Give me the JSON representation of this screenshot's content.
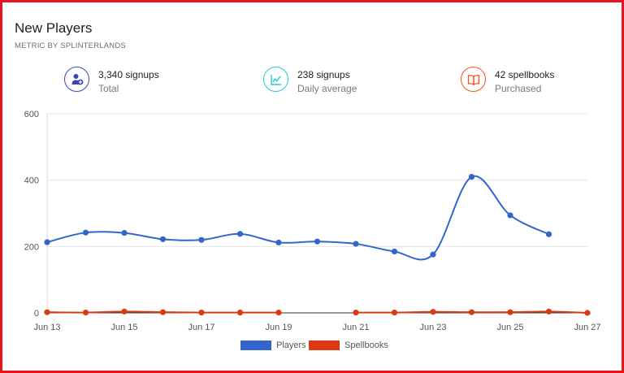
{
  "header": {
    "title": "New Players",
    "subtitle": "METRIC BY SPLINTERLANDS"
  },
  "stats": [
    {
      "value": "3,340 signups",
      "label": "Total",
      "color": "#3949ab",
      "icon": "user-add-icon"
    },
    {
      "value": "238 signups",
      "label": "Daily average",
      "color": "#26c6da",
      "icon": "line-chart-icon"
    },
    {
      "value": "42 spellbooks",
      "label": "Purchased",
      "color": "#f4511e",
      "icon": "book-icon"
    }
  ],
  "colors": {
    "border": "#e8141b",
    "players": "#3366cc",
    "spellbooks": "#dc3912"
  },
  "chart_data": {
    "type": "line",
    "x": [
      "Jun 13",
      "Jun 14",
      "Jun 15",
      "Jun 16",
      "Jun 17",
      "Jun 18",
      "Jun 19",
      "Jun 20",
      "Jun 21",
      "Jun 22",
      "Jun 23",
      "Jun 24",
      "Jun 25",
      "Jun 26",
      "Jun 27"
    ],
    "x_tick_labels": [
      "Jun 13",
      "Jun 15",
      "Jun 17",
      "Jun 19",
      "Jun 21",
      "Jun 23",
      "Jun 25",
      "Jun 27"
    ],
    "y_ticks": [
      0,
      200,
      400,
      600
    ],
    "ylim": [
      0,
      600
    ],
    "grid": true,
    "legend_position": "bottom",
    "series": [
      {
        "name": "Players",
        "color": "#3366cc",
        "values": [
          213,
          242,
          241,
          222,
          220,
          238,
          212,
          215,
          208,
          185,
          176,
          410,
          294,
          237,
          null
        ]
      },
      {
        "name": "Spellbooks",
        "color": "#dc3912",
        "values": [
          2,
          1,
          4,
          2,
          1,
          1,
          1,
          null,
          1,
          1,
          3,
          2,
          2,
          4,
          0
        ]
      }
    ]
  }
}
